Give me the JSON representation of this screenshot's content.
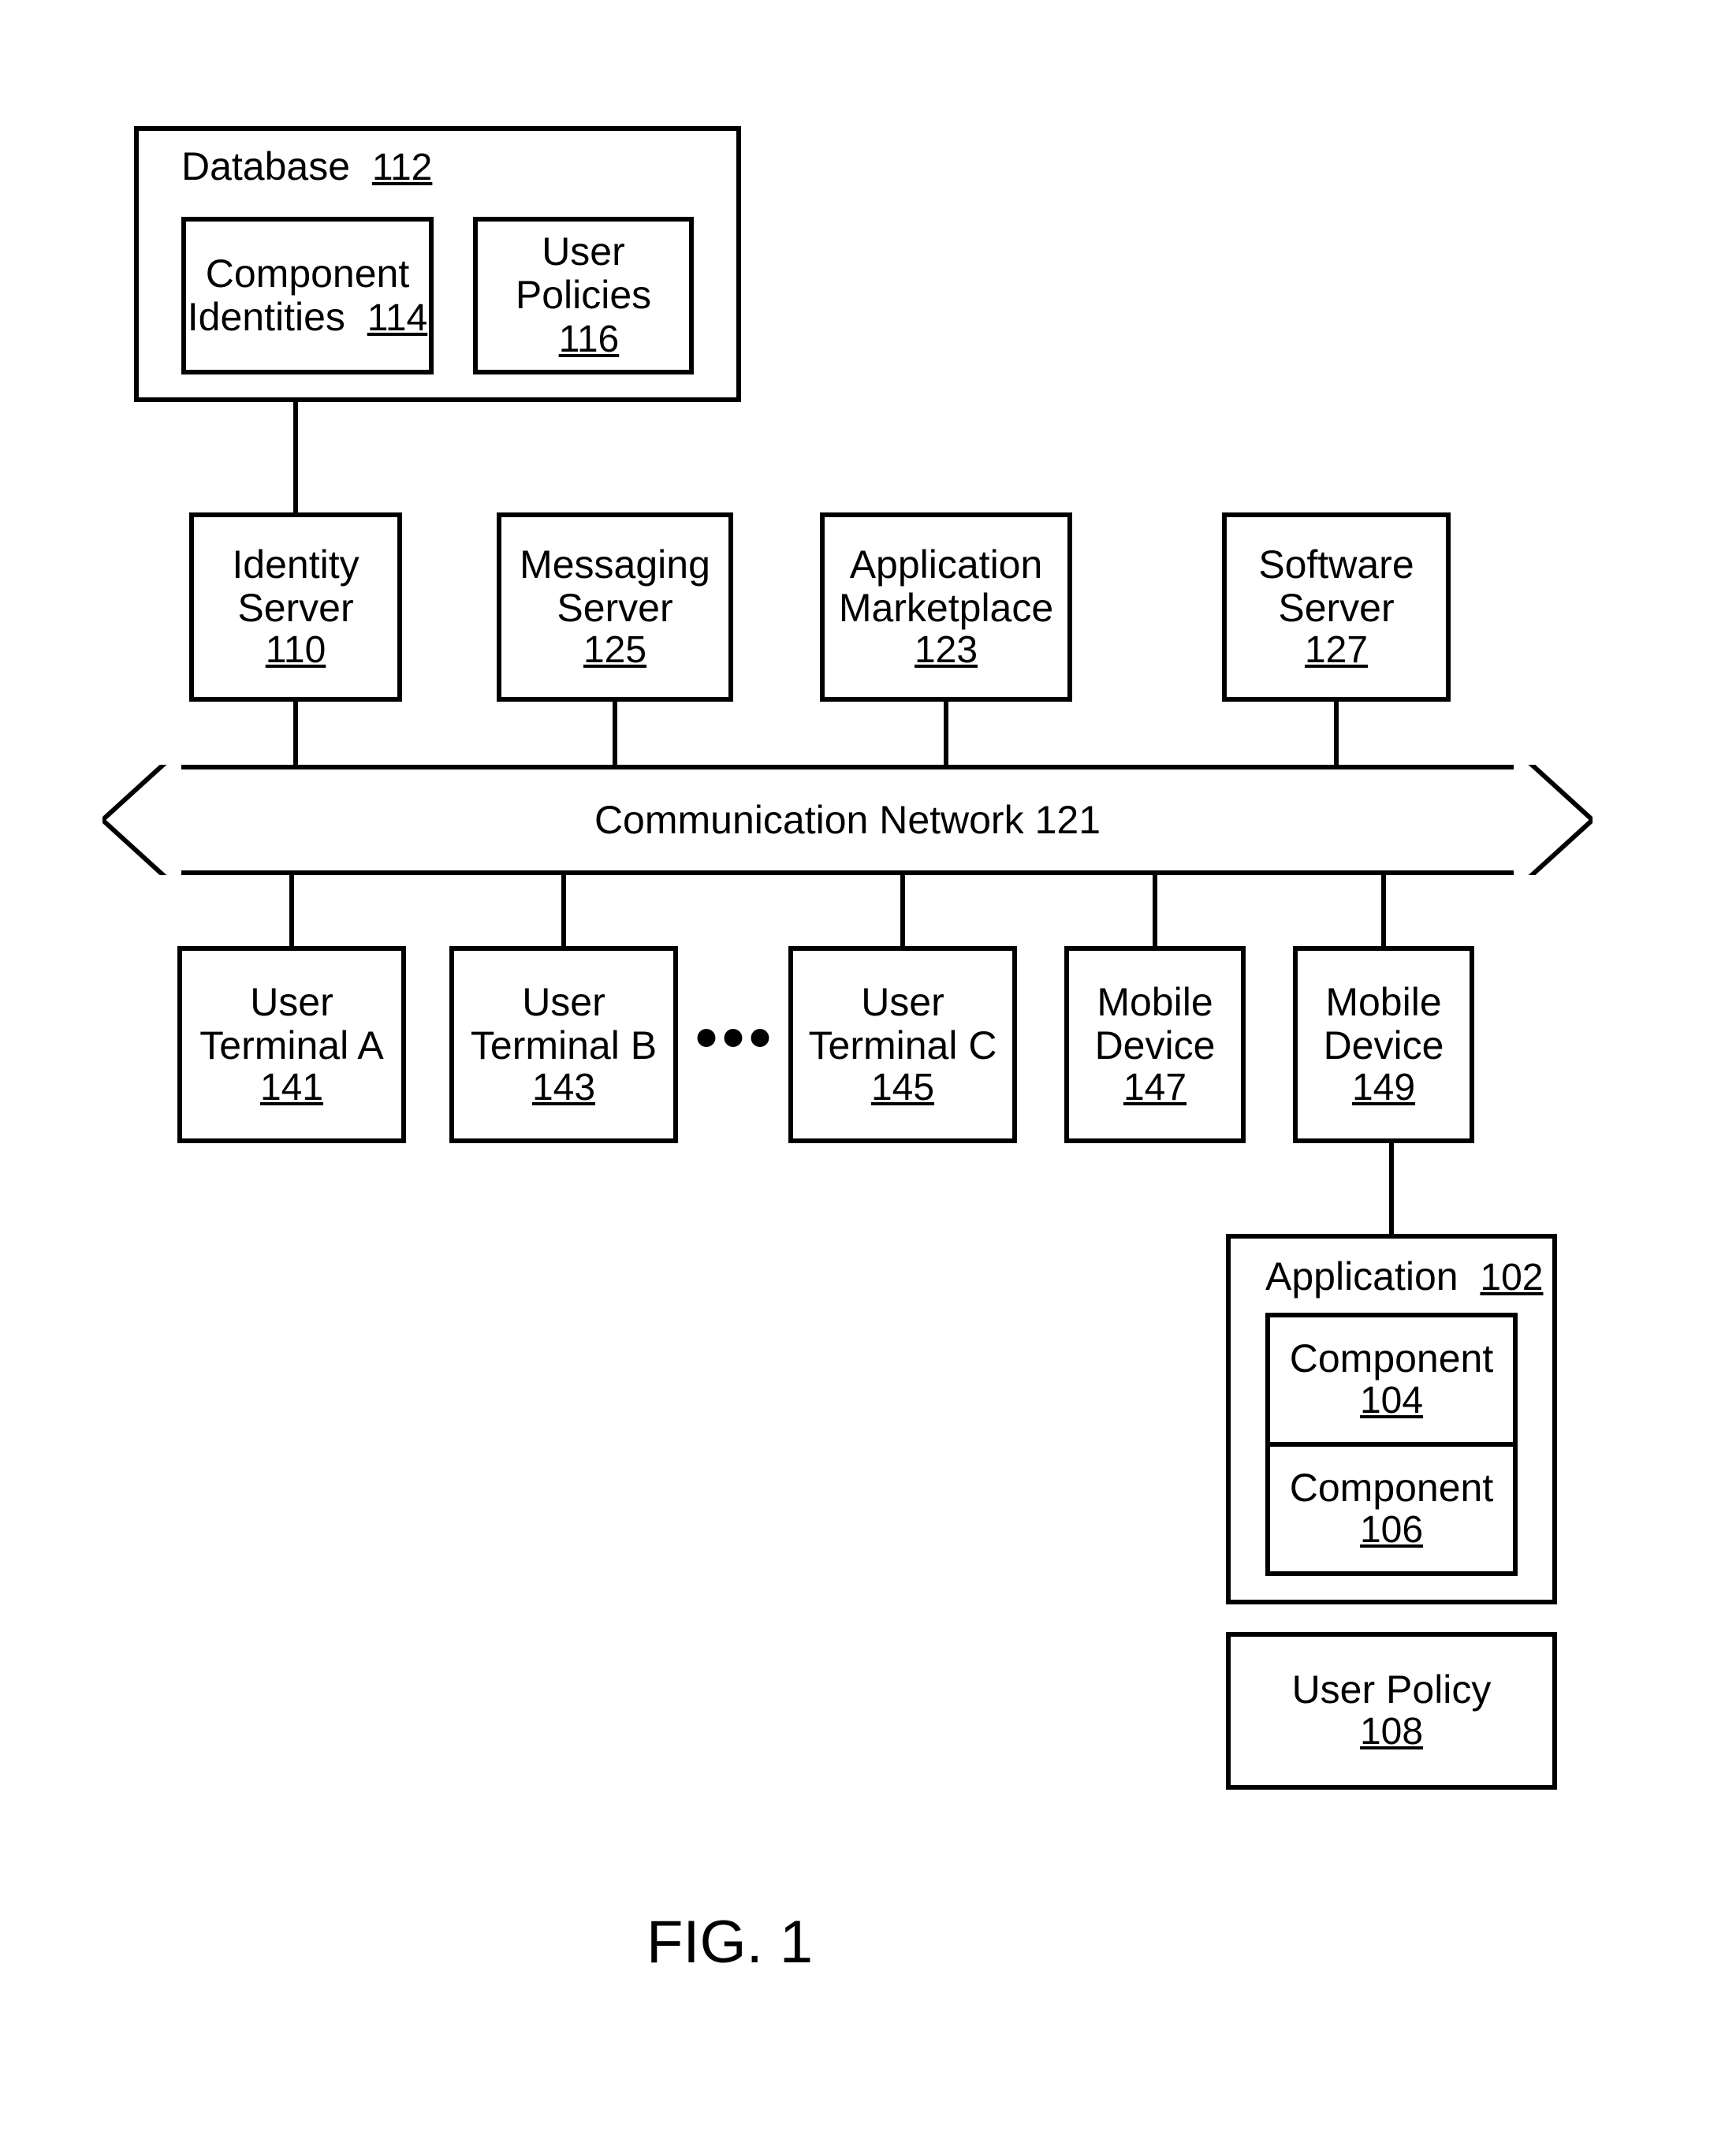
{
  "figure_label": "FIG. 1",
  "network": {
    "label": "Communication Network",
    "ref": "121"
  },
  "ellipsis": "•••",
  "database": {
    "label": "Database",
    "ref": "112",
    "children": {
      "comp_ids": {
        "l1": "Component",
        "l2": "Identities",
        "ref": "114"
      },
      "user_pol": {
        "l1": "User",
        "l2": "Policies",
        "ref": "116"
      }
    }
  },
  "servers": {
    "identity": {
      "l1": "Identity",
      "l2": "Server",
      "ref": "110"
    },
    "messaging": {
      "l1": "Messaging",
      "l2": "Server",
      "ref": "125"
    },
    "marketplace": {
      "l1": "Application",
      "l2": "Marketplace",
      "ref": "123"
    },
    "software": {
      "l1": "Software",
      "l2": "Server",
      "ref": "127"
    }
  },
  "clients": {
    "ut_a": {
      "l1": "User",
      "l2": "Terminal A",
      "ref": "141"
    },
    "ut_b": {
      "l1": "User",
      "l2": "Terminal B",
      "ref": "143"
    },
    "ut_c": {
      "l1": "User",
      "l2": "Terminal C",
      "ref": "145"
    },
    "mob_1": {
      "l1": "Mobile",
      "l2": "Device",
      "ref": "147"
    },
    "mob_2": {
      "l1": "Mobile",
      "l2": "Device",
      "ref": "149"
    }
  },
  "app": {
    "label": "Application",
    "ref": "102",
    "comp1": {
      "l1": "Component",
      "ref": "104"
    },
    "comp2": {
      "l1": "Component",
      "ref": "106"
    },
    "user_policy": {
      "l1": "User Policy",
      "ref": "108"
    }
  },
  "colors": {
    "stroke": "#000000",
    "bg": "#ffffff"
  }
}
